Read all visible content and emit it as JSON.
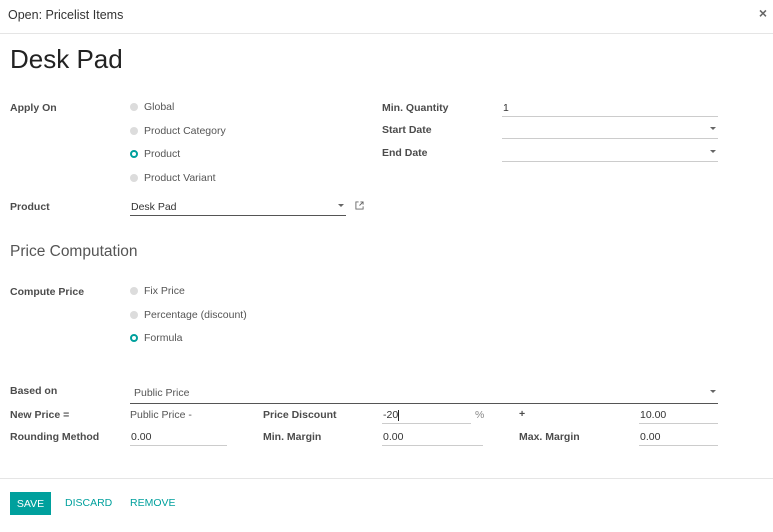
{
  "dialog": {
    "title": "Open: Pricelist Items",
    "close_icon": "×"
  },
  "record": {
    "name": "Desk Pad"
  },
  "apply_on": {
    "label": "Apply On",
    "options": [
      {
        "label": "Global",
        "selected": false
      },
      {
        "label": "Product Category",
        "selected": false
      },
      {
        "label": "Product",
        "selected": true
      },
      {
        "label": "Product Variant",
        "selected": false
      }
    ]
  },
  "product": {
    "label": "Product",
    "value": "Desk Pad",
    "external_link_icon": "external-link-icon"
  },
  "min_quantity": {
    "label": "Min. Quantity",
    "value": "1"
  },
  "start_date": {
    "label": "Start Date",
    "value": ""
  },
  "end_date": {
    "label": "End Date",
    "value": ""
  },
  "section_title": "Price Computation",
  "compute_price": {
    "label": "Compute Price",
    "options": [
      {
        "label": "Fix Price",
        "selected": false
      },
      {
        "label": "Percentage (discount)",
        "selected": false
      },
      {
        "label": "Formula",
        "selected": true
      }
    ]
  },
  "based_on": {
    "label": "Based on",
    "value": "Public Price"
  },
  "new_price": {
    "label": "New Price =",
    "formula_text": "Public Price -"
  },
  "price_discount": {
    "label": "Price Discount",
    "value": "-20",
    "suffix": "%"
  },
  "surcharge": {
    "label": "+",
    "value": "10.00"
  },
  "rounding_method": {
    "label": "Rounding Method",
    "value": "0.00"
  },
  "min_margin": {
    "label": "Min. Margin",
    "value": "0.00"
  },
  "max_margin": {
    "label": "Max. Margin",
    "value": "0.00"
  },
  "footer": {
    "save": "SAVE",
    "discard": "DISCARD",
    "remove": "REMOVE"
  },
  "colors": {
    "accent": "#00a09d"
  }
}
